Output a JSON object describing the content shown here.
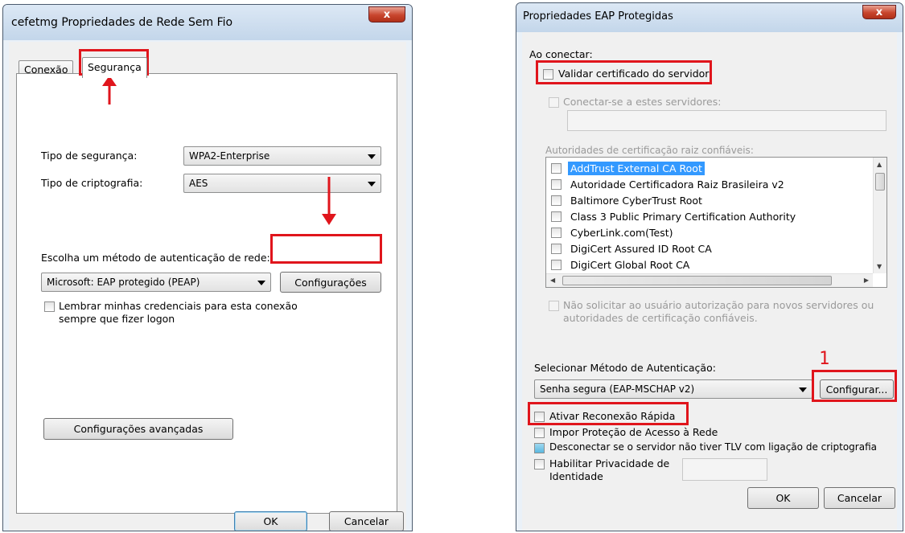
{
  "left_dialog": {
    "title": "cefetmg Propriedades de Rede Sem Fio",
    "close_label": "x",
    "tabs": [
      "Conexão",
      "Segurança"
    ],
    "active_tab": "Segurança",
    "security_type_label": "Tipo de segurança:",
    "security_type_value": "WPA2-Enterprise",
    "encryption_type_label": "Tipo de criptografia:",
    "encryption_type_value": "AES",
    "auth_method_label": "Escolha um método de autenticação de rede:",
    "auth_method_value": "Microsoft: EAP protegido (PEAP)",
    "settings_button": "Configurações",
    "remember_credentials_label_line1": "Lembrar minhas credenciais para esta conexão",
    "remember_credentials_label_line2": "sempre que fizer logon",
    "advanced_settings_button": "Configurações avançadas",
    "ok_button": "OK",
    "cancel_button": "Cancelar"
  },
  "right_dialog": {
    "title": "Propriedades EAP Protegidas",
    "close_label": "x",
    "on_connect_label": "Ao conectar:",
    "validate_cert_label": "Validar certificado do servidor",
    "connect_to_servers_label": "Conectar-se a estes servidores:",
    "root_ca_label": "Autoridades de certificação raiz confiáveis:",
    "ca_list": [
      "AddTrust External CA Root",
      "Autoridade Certificadora Raiz Brasileira v2",
      "Baltimore CyberTrust Root",
      "Class 3 Public Primary Certification Authority",
      "CyberLink.com(Test)",
      "DigiCert Assured ID Root CA",
      "DigiCert Global Root CA"
    ],
    "selected_ca": "AddTrust External CA Root",
    "no_prompt_label_line1": "Não solicitar ao usuário autorização para novos servidores ou",
    "no_prompt_label_line2": "autoridades de certificação confiáveis.",
    "select_auth_method_label": "Selecionar Método de Autenticação:",
    "auth_method_value": "Senha segura (EAP-MSCHAP v2)",
    "configure_button": "Configurar...",
    "fast_reconnect_label": "Ativar Reconexão Rápida",
    "nap_label": "Impor Proteção de Acesso à Rede",
    "disconnect_tlv_label": "Desconectar se o servidor não tiver TLV com ligação de criptografia",
    "identity_privacy_label_line1": "Habilitar Privacidade de",
    "identity_privacy_label_line2": "Identidade",
    "ok_button": "OK",
    "cancel_button": "Cancelar"
  },
  "annotations": {
    "step_number": "1",
    "accent_color": "#e0151c"
  }
}
